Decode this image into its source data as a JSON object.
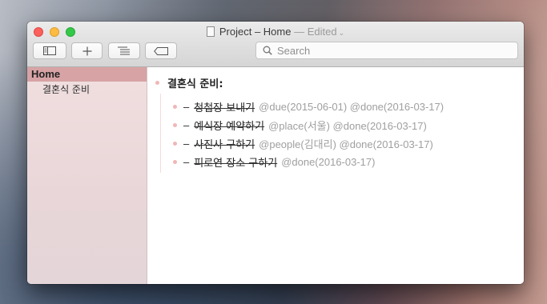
{
  "window": {
    "title": "Project – Home",
    "status": "— Edited",
    "status_caret": "⌄"
  },
  "toolbar": {
    "buttons": [
      {
        "icon": "sidebar-toggle-icon"
      },
      {
        "icon": "plus-icon"
      },
      {
        "icon": "list-indent-icon"
      },
      {
        "icon": "tag-icon"
      }
    ],
    "search_placeholder": "Search"
  },
  "sidebar": {
    "home_label": "Home",
    "items": [
      {
        "label": "결혼식 준비"
      }
    ]
  },
  "document": {
    "project": "결혼식 준비:",
    "tasks": [
      {
        "dash": "–",
        "text": "청첩장 보내기",
        "tags": "@due(2015-06-01) @done(2016-03-17)"
      },
      {
        "dash": "–",
        "text": "예식장 예약하기",
        "tags": "@place(서울) @done(2016-03-17)"
      },
      {
        "dash": "–",
        "text": "사진사 구하기",
        "tags": "@people(김대리) @done(2016-03-17)"
      },
      {
        "dash": "–",
        "text": "피로연 장소 구하기",
        "tags": "@done(2016-03-17)"
      }
    ]
  },
  "colors": {
    "sidebar_selected": "#d7a3a5",
    "bullet": "#f2b6b6",
    "tag_text": "#9f9f9f"
  }
}
